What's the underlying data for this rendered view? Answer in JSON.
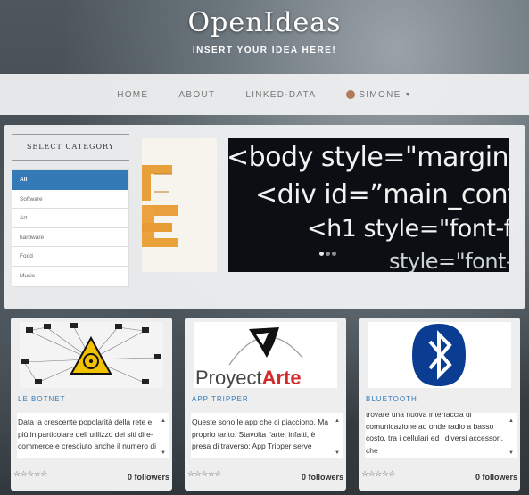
{
  "header": {
    "title": "OpenIdeas",
    "tagline": "INSERT YOUR IDEA HERE!"
  },
  "nav": {
    "items": [
      "HOME",
      "ABOUT",
      "LINKED-DATA"
    ],
    "user": "SIMONE"
  },
  "categories": {
    "title": "SELECT CATEGORY",
    "items": [
      "All",
      "Software",
      "Art",
      "hardware",
      "Food",
      "Music"
    ],
    "active": "All"
  },
  "carousel": {
    "code_lines": [
      "<body style=\"margin",
      "<div id=”main_cont",
      "<h1 style=\"font-f",
      "style=\"font-"
    ]
  },
  "cards": [
    {
      "title": "LE BOTNET",
      "description": "Data la crescente popolarità della rete e più in particolare dell utilizzo dei siti di e-commerce e cresciuto anche il numero di",
      "followers": "0 followers",
      "rating": "☆☆☆☆☆"
    },
    {
      "title": "APP TRIPPER",
      "image_caption": "ProyectArte",
      "description": "Queste sono le app che ci piacciono. Ma proprio tanto. Stavolta l'arte, infatti, è presa di traverso: App Tripper serve",
      "followers": "0 followers",
      "rating": "☆☆☆☆☆"
    },
    {
      "title": "BLUETOOTH",
      "description": "trovare una nuova interfaccia di comunicazione ad onde radio a basso costo, tra i cellulari ed i diversi accessori, che",
      "followers": "0 followers",
      "rating": "☆☆☆☆☆"
    }
  ],
  "colors": {
    "accent": "#337ab7",
    "nav_bg": "#eeeff0"
  }
}
